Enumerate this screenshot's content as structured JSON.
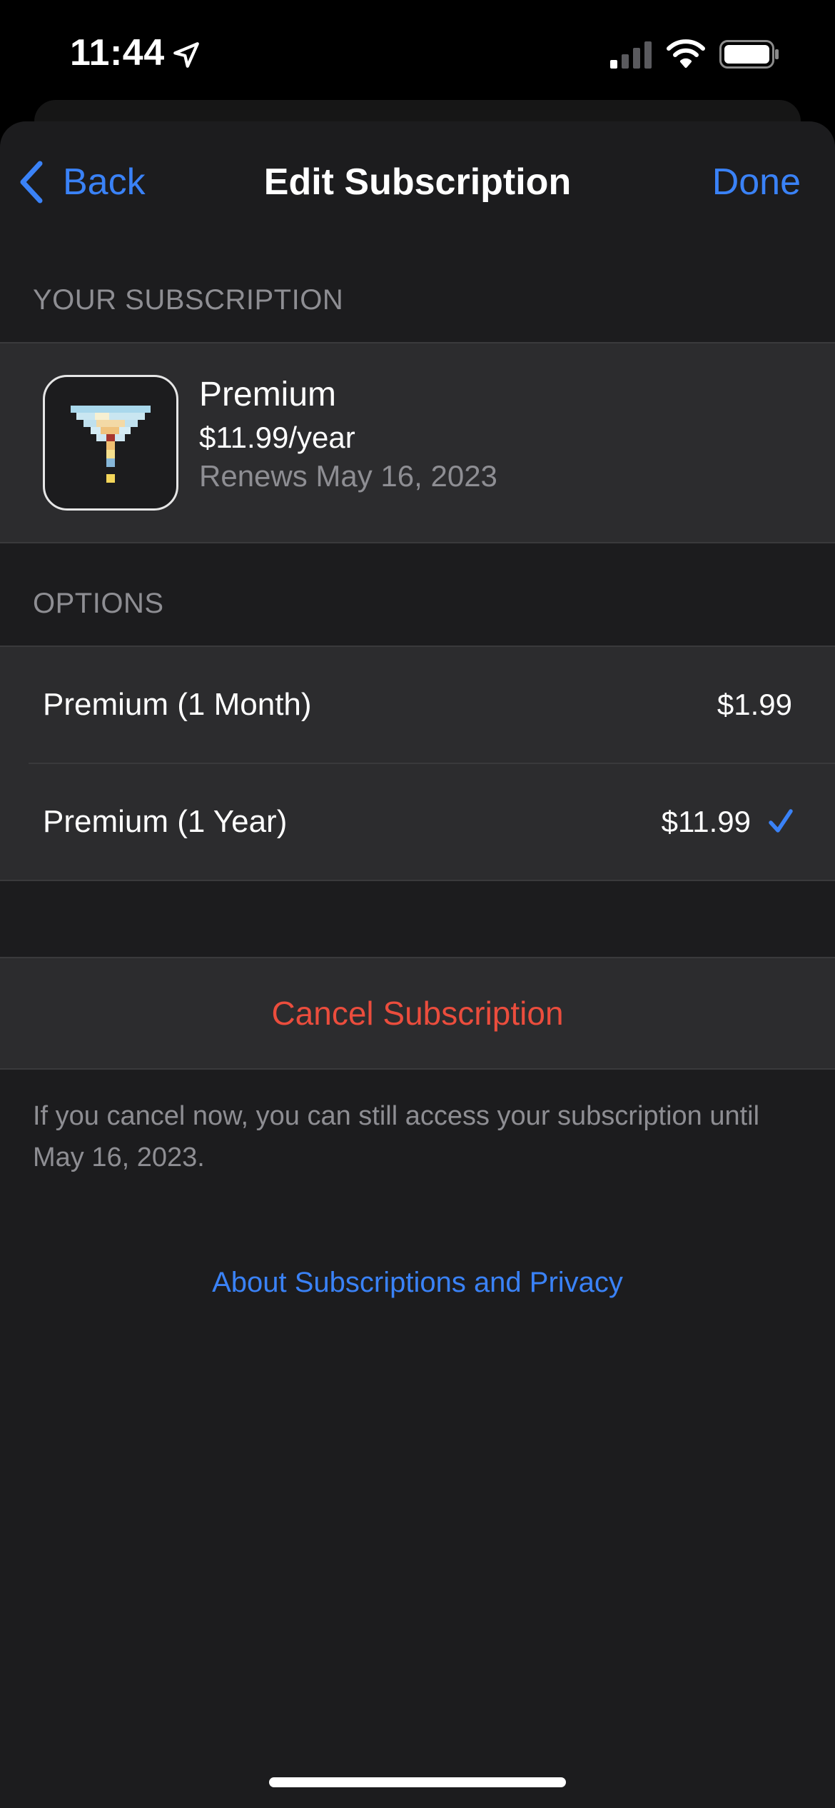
{
  "status_bar": {
    "time": "11:44",
    "icons": [
      "location-arrow-icon",
      "cellular-signal-icon",
      "wifi-icon",
      "battery-icon"
    ]
  },
  "nav": {
    "back_label": "Back",
    "title": "Edit Subscription",
    "done_label": "Done"
  },
  "subscription_section": {
    "header": "YOUR SUBSCRIPTION",
    "name": "Premium",
    "price": "$11.99/year",
    "renewal": "Renews May 16, 2023"
  },
  "options_section": {
    "header": "OPTIONS",
    "options": [
      {
        "label": "Premium (1 Month)",
        "price": "$1.99",
        "selected": false
      },
      {
        "label": "Premium (1 Year)",
        "price": "$11.99",
        "selected": true
      }
    ]
  },
  "cancel": {
    "label": "Cancel Subscription",
    "footnote": "If you cancel now, you can still access your subscription until May 16, 2023."
  },
  "about_link": "About Subscriptions and Privacy",
  "colors": {
    "accent": "#3a82f7",
    "destructive": "#eb4d3d",
    "background": "#1c1c1e",
    "cell": "#2c2c2e",
    "secondary_text": "#8e8e93"
  }
}
